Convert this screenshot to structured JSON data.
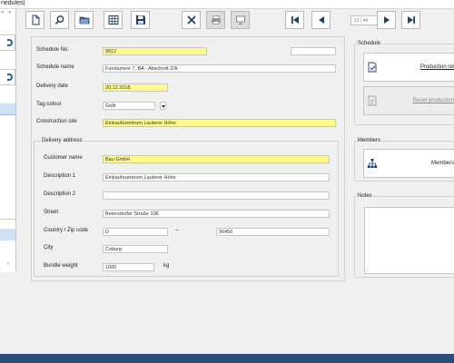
{
  "window": {
    "title": "nedules|"
  },
  "left_panel": {
    "nav_left": "«",
    "nav_right": "»",
    "arrow": "›"
  },
  "toolbar": {
    "buttons": [
      {
        "name": "new-document-button",
        "icon": "new-document-icon"
      },
      {
        "name": "search-button",
        "icon": "search-icon"
      },
      {
        "name": "open-folder-button",
        "icon": "folder-icon"
      },
      {
        "name": "table-view-button",
        "icon": "table-icon"
      },
      {
        "name": "save-button",
        "icon": "save-icon"
      },
      {
        "name": "delete-button",
        "icon": "close-icon"
      },
      {
        "name": "print-button",
        "icon": "printer-icon"
      },
      {
        "name": "preview-button",
        "icon": "monitor-icon"
      },
      {
        "name": "first-record-button",
        "icon": "skip-first-icon"
      },
      {
        "name": "previous-record-button",
        "icon": "previous-icon"
      },
      {
        "name": "next-record-button",
        "icon": "next-icon"
      },
      {
        "name": "last-record-button",
        "icon": "skip-last-icon"
      }
    ],
    "record_nav": "13 | 44"
  },
  "form": {
    "schedule_no": {
      "label": "Schedule No.",
      "value": "9912"
    },
    "schedule_name": {
      "label": "Schedule name",
      "value": "Fundament 7. BA - Abschnitt 2/A"
    },
    "delivery_date": {
      "label": "Delivery date",
      "value": "20.12.2018"
    },
    "tag_colour": {
      "label": "Tag colour",
      "value": "Gelb"
    },
    "construction_site": {
      "label": "Construction site",
      "value": "Einkaufszentrum Lauterer Höhe"
    },
    "delivery_address": {
      "title": "Delivery address",
      "customer_name": {
        "label": "Customer name",
        "value": "Bau GmbH"
      },
      "description1": {
        "label": "Description 1",
        "value": "Einkaufszentrum Lauterer Höhe"
      },
      "description2": {
        "label": "Description 2",
        "value": ""
      },
      "street": {
        "label": "Street",
        "value": "Beiersdorfer Straße 106"
      },
      "country_zip": {
        "label": "Country / Zip code",
        "country": "D",
        "separator": "–",
        "zip": "96450"
      },
      "city": {
        "label": "City",
        "value": "Coburg"
      },
      "bundle_weight": {
        "label": "Bundle weight",
        "value": "1000",
        "unit": "kg"
      }
    }
  },
  "right_panels": {
    "schedule": {
      "title": "Schedule",
      "production_release": "Production rel",
      "reset_production": "Reset production"
    },
    "members": {
      "title": "Members",
      "button": "Members"
    },
    "notes": {
      "title": "Notes",
      "scroll_arrow": "‹"
    }
  },
  "colors": {
    "required_field": "#fffb8a",
    "accent": "#1f5fa8",
    "status_bar": "#2a4d7a",
    "selection": "#cfe0f3"
  }
}
